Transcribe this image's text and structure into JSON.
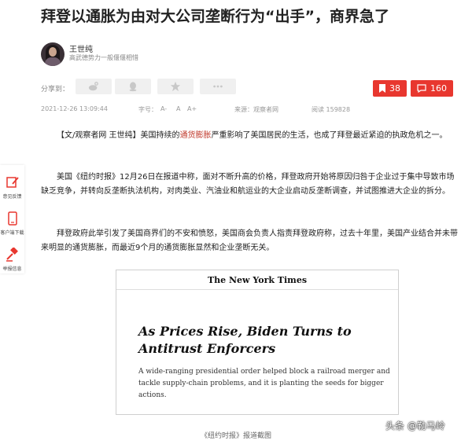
{
  "article": {
    "title": "拜登以通胀为由对大公司垄断行为“出手”，商界急了",
    "author_name": "王世纯",
    "author_bio": "高武德势力一般偃偃相惜",
    "share_label": "分享到：",
    "likes_count": "38",
    "comments_count": "160",
    "date": "2021-12-26 13:09:44",
    "font_label": "字号：",
    "font_small": "A-",
    "font_mid": "A",
    "font_large": "A+",
    "source_label": "来源：观察者网",
    "views_label": "阅读 159828"
  },
  "body": {
    "p1_pre": "【文/观察者网 王世纯】美国持续的",
    "p1_link": "通货膨胀",
    "p1_post": "严重影响了美国居民的生活，也成了拜登最近紧迫的执政危机之一。",
    "p2": "美国《纽约时报》12月26日在报道中称，面对不断升高的价格，拜登政府开始将原因归咎于企业过于集中导致市场缺乏竞争，并转向反垄断执法机构，对肉类业、汽油业和航运业的大企业启动反垄断调查，并试图推进大企业的拆分。",
    "p3": "拜登政府此举引发了美国商界们的不安和愤怒，美国商会负责人指责拜登政府称，过去十年里，美国产业结合并未带来明显的通货膨胀，而最近9个月的通货膨胀显然和企业垄断无关。"
  },
  "sidebar": {
    "feedback": "意见反馈",
    "download": "客户端下载",
    "letter": "举报信息"
  },
  "figure": {
    "masthead": "The New York Times",
    "headline": "As Prices Rise, Biden Turns to Antitrust Enforcers",
    "dek": "A wide-ranging presidential order helped block a railroad merger and tackle supply-chain problems, and it is planting the seeds for bigger actions.",
    "caption": "《纽约时报》报道截图"
  },
  "watermark": "头条 @勒马岭",
  "colors": {
    "accent": "#e8372f",
    "link": "#c0392b"
  }
}
